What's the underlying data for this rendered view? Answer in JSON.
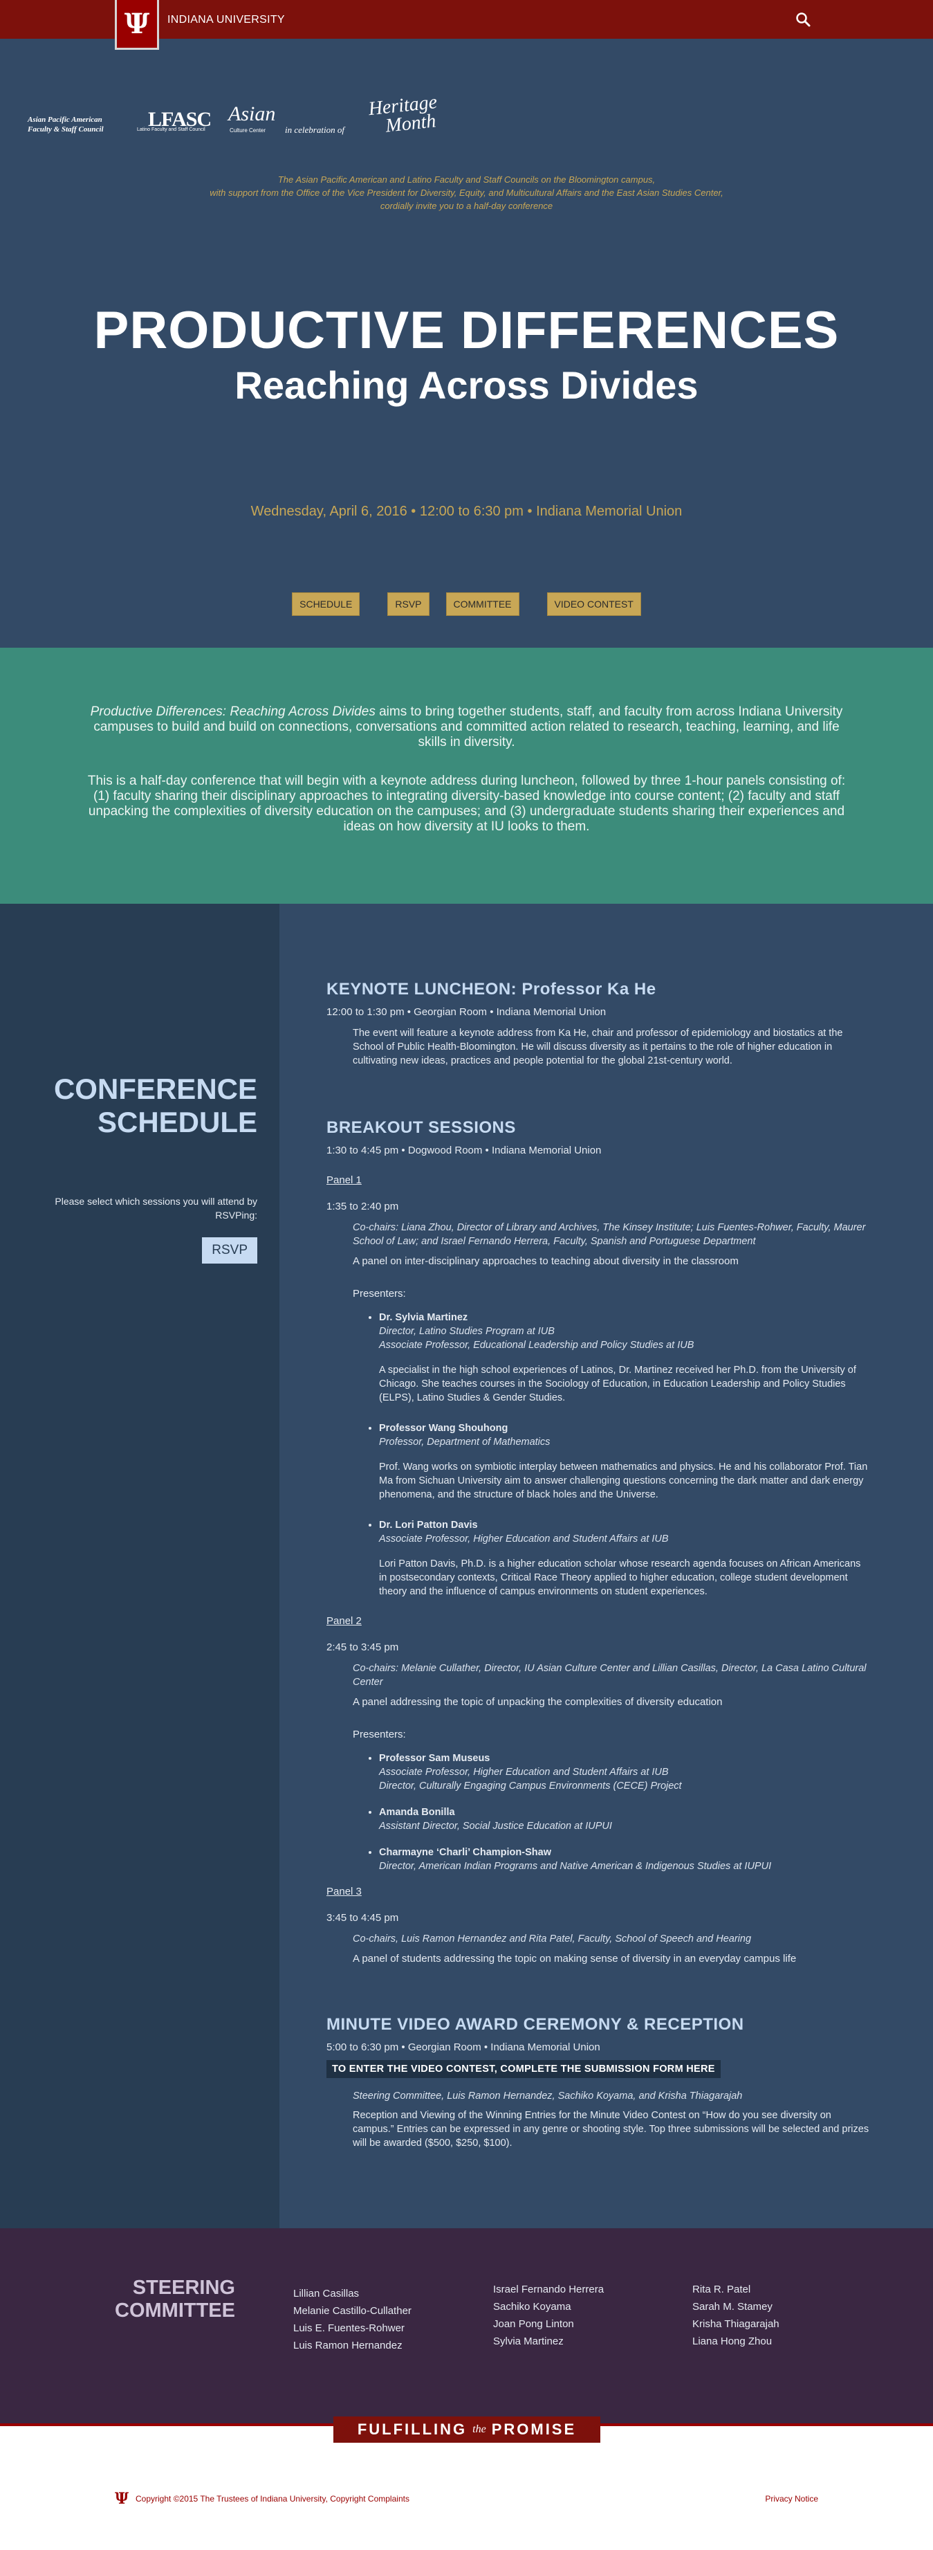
{
  "header": {
    "brand": "INDIANA UNIVERSITY",
    "logo_mark": "Ψ",
    "search_icon": "search-icon"
  },
  "partners": {
    "apa_line1": "Asian Pacific American",
    "apa_line2": "Faculty & Staff Council",
    "lfasc": "LFASC",
    "lfasc_sub": "Latino Faculty and Staff Council",
    "asian": "Asian",
    "asian_sub": "Culture Center",
    "celebration": "in celebration of",
    "heritage_line1": "Heritage",
    "heritage_line2": "Month"
  },
  "hero": {
    "invite_line1": "The Asian Pacific American and Latino Faculty and Staff Councils on the Bloomington campus,",
    "invite_line2": "with support from the Office of the Vice President for Diversity, Equity, and Multicultural Affairs and the East Asian Studies Center,",
    "invite_line3": "cordially invite you to a half-day conference",
    "title": "PRODUCTIVE DIFFERENCES",
    "subtitle": "Reaching Across Divides",
    "dateline": "Wednesday, April 6, 2016 • 12:00 to 6:30 pm • Indiana Memorial Union",
    "nav": [
      "SCHEDULE",
      "RSVP",
      "COMMITTEE",
      "VIDEO CONTEST"
    ]
  },
  "intro": {
    "p1_em": "Productive Differences: Reaching Across Divides",
    "p1_rest": " aims to bring together students, staff, and faculty from across Indiana University campuses to build and build on connections, conversations and committed action related to research, teaching, learning, and life skills in diversity.",
    "p2": "This is a half-day conference that will begin with a keynote address during luncheon, followed by three 1-hour panels consisting of: (1) faculty sharing their disciplinary approaches to integrating diversity-based knowledge into course content; (2) faculty and staff unpacking the complexities of diversity education on the campuses; and (3) undergraduate students sharing their experiences and ideas on how diversity at IU looks to them."
  },
  "sidebar": {
    "title_line1": "CONFERENCE",
    "title_line2": "SCHEDULE",
    "note": "Please select which sessions you will attend by RSVPing:",
    "rsvp": "RSVP"
  },
  "keynote": {
    "title": "KEYNOTE LUNCHEON: Professor Ka He",
    "meta": "12:00 to 1:30 pm • Georgian Room • Indiana Memorial Union",
    "desc": "The event will feature a keynote address from Ka He, chair and professor of epidemiology and biostatics at the School of Public Health-Bloomington. He will discuss diversity as it pertains to the role of higher education in cultivating new ideas, practices and people potential for the global 21st-century world."
  },
  "breakout": {
    "title": "BREAKOUT SESSIONS",
    "meta": "1:30 to 4:45 pm • Dogwood Room • Indiana Memorial Union",
    "presenters_label": "Presenters:",
    "panel1": {
      "label": "Panel 1",
      "time": "1:35 to 2:40 pm",
      "chairs": "Co-chairs: Liana Zhou, Director of Library and Archives, The Kinsey Institute; Luis Fuentes-Rohwer, Faculty, Maurer School of Law; and Israel Fernando Herrera, Faculty, Spanish and Portuguese Department",
      "desc": "A panel on inter-disciplinary approaches to teaching about diversity in the classroom",
      "presenters": [
        {
          "name": "Dr. Sylvia Martinez",
          "role1": "Director, Latino Studies Program at IUB",
          "role2": "Associate Professor, Educational Leadership and Policy Studies at IUB",
          "bio": "A specialist in the high school experiences of Latinos, Dr. Martinez received her Ph.D. from the University of Chicago. She teaches courses in the Sociology of Education, in Education Leadership and Policy Studies (ELPS), Latino Studies & Gender Studies."
        },
        {
          "name": "Professor Wang Shouhong",
          "role1": "Professor, Department of Mathematics",
          "bio": "Prof. Wang works on symbiotic interplay between mathematics and physics. He and his collaborator Prof. Tian Ma from Sichuan University aim to answer challenging questions concerning the dark matter and dark energy phenomena, and the structure of black holes and the Universe."
        },
        {
          "name": "Dr. Lori Patton Davis",
          "role1": "Associate Professor, Higher Education and Student Affairs at IUB",
          "bio": "Lori Patton Davis, Ph.D. is a higher education scholar whose research agenda focuses on African Americans in postsecondary contexts, Critical Race Theory applied to higher education, college student development theory and the influence of campus environments on student experiences."
        }
      ]
    },
    "panel2": {
      "label": "Panel 2",
      "time": "2:45 to 3:45 pm",
      "chairs": "Co-chairs: Melanie Cullather, Director, IU Asian Culture Center and Lillian Casillas, Director, La Casa Latino Cultural Center",
      "desc": "A panel addressing the topic of unpacking the complexities of diversity education",
      "presenters": [
        {
          "name": "Professor Sam Museus",
          "role1": "Associate Professor, Higher Education and Student Affairs at IUB",
          "role2": "Director, Culturally Engaging Campus Environments (CECE) Project"
        },
        {
          "name": "Amanda Bonilla",
          "role1": "Assistant Director, Social Justice Education at IUPUI"
        },
        {
          "name": "Charmayne ‘Charli’ Champion-Shaw",
          "role1": "Director, American Indian Programs and Native American & Indigenous Studies at IUPUI"
        }
      ]
    },
    "panel3": {
      "label": "Panel 3",
      "time": "3:45 to 4:45 pm",
      "chairs": "Co-chairs, Luis Ramon Hernandez and Rita Patel, Faculty, School of Speech and Hearing",
      "desc": "A panel of students addressing the topic on making sense of diversity in an everyday campus life"
    }
  },
  "reception": {
    "title": "MINUTE VIDEO AWARD CEREMONY & RECEPTION",
    "meta": "5:00 to 6:30 pm • Georgian Room • Indiana Memorial Union",
    "contest_link": "TO ENTER THE VIDEO CONTEST, COMPLETE THE SUBMISSION FORM HERE",
    "committee": "Steering Committee, Luis Ramon Hernandez, Sachiko Koyama, and Krisha Thiagarajah",
    "desc": "Reception and Viewing of the Winning Entries for the Minute Video Contest on “How do you see diversity on campus.” Entries can be expressed in any genre or shooting style. Top three submissions will be selected and prizes will be awarded ($500, $250, $100)."
  },
  "steering": {
    "title_line1": "STEERING",
    "title_line2": "COMMITTEE",
    "col1": [
      "Lillian Casillas",
      "Melanie Castillo-Cullather",
      "Luis E. Fuentes-Rohwer",
      "Luis Ramon Hernandez"
    ],
    "col2": [
      "Israel Fernando Herrera",
      "Sachiko Koyama",
      "Joan Pong Linton",
      "Sylvia Martinez"
    ],
    "col3": [
      "Rita R. Patel",
      "Sarah M. Stamey",
      "Krisha Thiagarajah",
      "Liana Hong Zhou"
    ]
  },
  "footer": {
    "promise_left": "FULFILLING",
    "promise_the": "the",
    "promise_right": "PROMISE",
    "copy_prefix": "Copyright ©2015 The Trustees of ",
    "copy_iu": "Indiana University",
    "copy_sep": ", ",
    "copy_link": "Copyright Complaints",
    "privacy": "Privacy Notice"
  }
}
